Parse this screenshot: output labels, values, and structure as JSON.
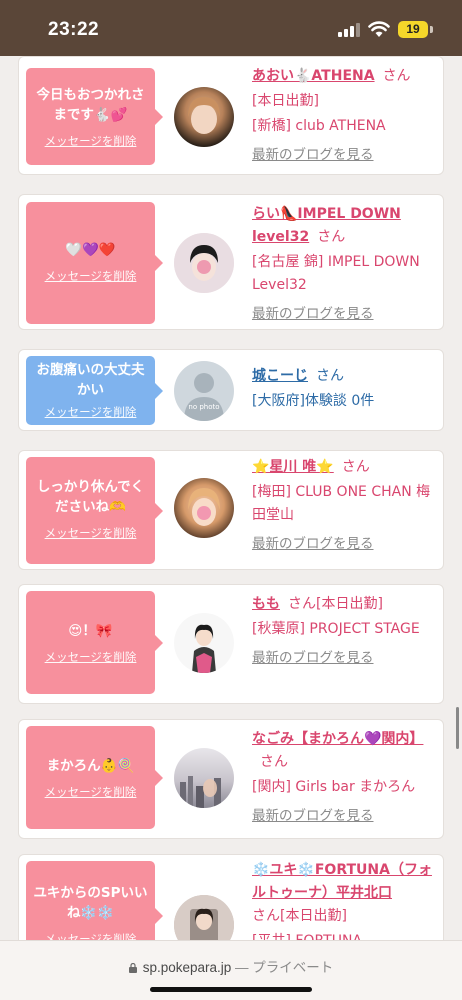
{
  "status_bar": {
    "time": "23:22",
    "battery": "19"
  },
  "messages": [
    {
      "bubble_color": "pink",
      "message": "今日もおつかれさまです🐇💕",
      "delete_label": "メッセージを削除",
      "name": "あおい🐇ATHENA",
      "san": "さん",
      "lines": [
        "[本日出勤]",
        "[新橋] club ATHENA"
      ],
      "blog_label": "最新のブログを見る"
    },
    {
      "bubble_color": "pink",
      "message": "🤍💜❤️",
      "delete_label": "メッセージを削除",
      "name": "らい👠IMPEL DOWN level32",
      "san": "さん",
      "lines": [
        "[名古屋 錦] IMPEL DOWN Level32"
      ],
      "blog_label": "最新のブログを見る"
    },
    {
      "bubble_color": "blue",
      "message": "お腹痛いの大丈夫かい",
      "delete_label": "メッセージを削除",
      "name": "城こーじ",
      "san": "さん",
      "lines": [
        "[大阪府]体験談 0件"
      ],
      "blog_label": ""
    },
    {
      "bubble_color": "pink",
      "message": "しっかり休んでくださいね🫶",
      "delete_label": "メッセージを削除",
      "name": "⭐星川 唯⭐",
      "san": "さん",
      "lines": [
        "[梅田] CLUB ONE CHAN 梅田堂山"
      ],
      "blog_label": "最新のブログを見る"
    },
    {
      "bubble_color": "pink",
      "message": "😍！🎀",
      "delete_label": "メッセージを削除",
      "name": "もも",
      "san": "さん[本日出勤]",
      "lines": [
        "[秋葉原] PROJECT STAGE"
      ],
      "blog_label": "最新のブログを見る"
    },
    {
      "bubble_color": "pink",
      "message": "まかろん👶🍭",
      "delete_label": "メッセージを削除",
      "name": "なごみ【まかろん💜関内】",
      "san": "さん",
      "lines": [
        "[関内] Girls bar まかろん"
      ],
      "blog_label": "最新のブログを見る"
    },
    {
      "bubble_color": "pink",
      "message": "ユキからのSPいいね❄️❄️",
      "delete_label": "メッセージを削除",
      "name": "❄️ユキ❄️FORTUNA（フォルトゥーナ）平井北口",
      "san": "さん[本日出勤]",
      "lines": [
        "[平井] FORTUNA"
      ],
      "blog_label": ""
    }
  ],
  "url_bar": {
    "domain": "sp.pokepara.jp",
    "suffix": " — プライベート"
  }
}
